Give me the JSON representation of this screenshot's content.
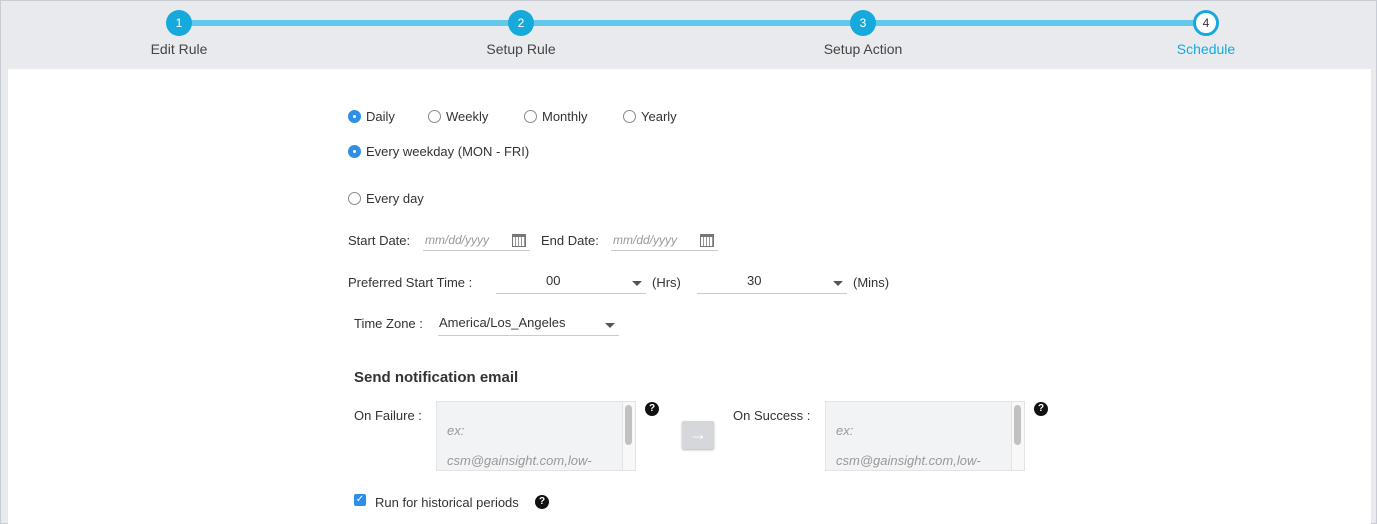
{
  "wizard": {
    "steps": [
      {
        "number": "1",
        "label": "Edit Rule"
      },
      {
        "number": "2",
        "label": "Setup Rule"
      },
      {
        "number": "3",
        "label": "Setup Action"
      },
      {
        "number": "4",
        "label": "Schedule"
      }
    ],
    "current_step": 4
  },
  "frequency": {
    "options": [
      "Daily",
      "Weekly",
      "Monthly",
      "Yearly"
    ],
    "selected": "Daily"
  },
  "daily_mode": {
    "weekday_label": "Every weekday (MON - FRI)",
    "everyday_label": "Every day",
    "selected": "Every weekday (MON - FRI)"
  },
  "dates": {
    "start_label": "Start Date:",
    "start_placeholder": "mm/dd/yyyy",
    "end_label": "End Date:",
    "end_placeholder": "mm/dd/yyyy"
  },
  "start_time": {
    "label": "Preferred Start Time :",
    "hours_value": "00",
    "hours_unit": "(Hrs)",
    "minutes_value": "30",
    "minutes_unit": "(Mins)"
  },
  "timezone": {
    "label": "Time Zone :",
    "value": "America/Los_Angeles"
  },
  "notification": {
    "heading": "Send notification email",
    "failure_label": "On Failure :",
    "failure_placeholder_line1": "ex:",
    "failure_placeholder_line2": "csm@gainsight.com,low-",
    "success_label": "On Success :",
    "success_placeholder_line1": "ex:",
    "success_placeholder_line2": "csm@gainsight.com,low-",
    "help_glyph": "?",
    "copy_arrow_glyph": "→"
  },
  "historical": {
    "label": "Run for historical periods",
    "checked": true,
    "check_glyph": "✓",
    "help_glyph": "?"
  },
  "colors": {
    "accent": "#16a9dc",
    "track": "#62c8ec",
    "radio_selected": "#2f8fe8"
  }
}
